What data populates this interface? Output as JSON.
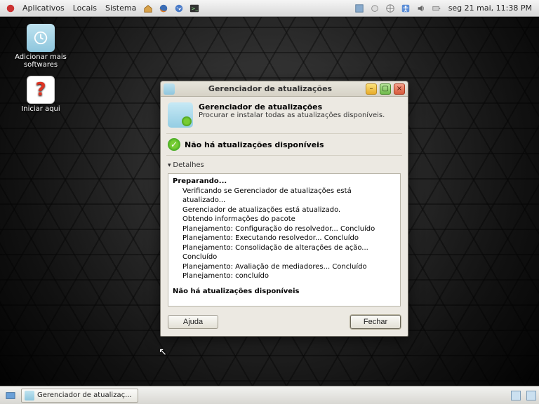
{
  "top_panel": {
    "menus": [
      "Aplicativos",
      "Locais",
      "Sistema"
    ],
    "clock": "seg 21 mai, 11:38 PM"
  },
  "desktop": {
    "icons": [
      {
        "label": "Adicionar mais softwares"
      },
      {
        "label": "Iniciar aqui"
      }
    ]
  },
  "window": {
    "title": "Gerenciador de atualizações",
    "header_title": "Gerenciador de atualizações",
    "header_sub": "Procurar e instalar todas as atualizações disponíveis.",
    "status": "Não há atualizações disponíveis",
    "details_label": "Detalhes",
    "log": {
      "preparing": "Preparando...",
      "lines": [
        "Verificando se Gerenciador de atualizações está atualizado...",
        "Gerenciador de atualizações está atualizado.",
        "Obtendo informações do pacote",
        "Planejamento: Configuração do resolvedor... Concluído",
        "Planejamento: Executando resolvedor... Concluído",
        "Planejamento: Consolidação de alterações de ação... Concluído",
        "Planejamento: Avaliação de mediadores... Concluído",
        "Planejamento: concluído"
      ],
      "final": "Não há atualizações disponíveis"
    },
    "buttons": {
      "help": "Ajuda",
      "close": "Fechar"
    }
  },
  "taskbar": {
    "active_task": "Gerenciador de atualizaç..."
  }
}
